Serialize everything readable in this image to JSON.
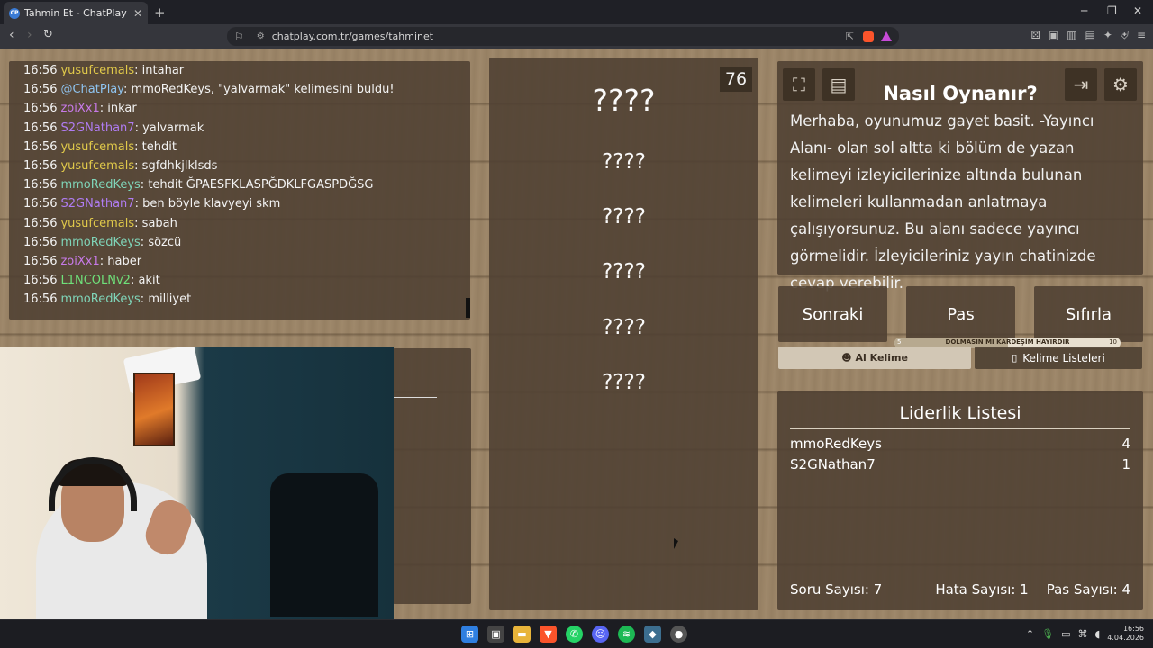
{
  "browser": {
    "tab_title": "Tahmin Et - ChatPlay",
    "tab_favicon": "CP",
    "url": "chatplay.com.tr/games/tahminet"
  },
  "chat": {
    "messages": [
      {
        "time": "16:56",
        "user": "yusufcemals",
        "color": "#e0c94a",
        "text": "intahar"
      },
      {
        "time": "16:56",
        "user": "@ChatPlay",
        "color": "#8fc4f0",
        "text": "mmoRedKeys, \"yalvarmak\" kelimesini buldu!"
      },
      {
        "time": "16:56",
        "user": "zoiXx1",
        "color": "#c77ae8",
        "text": "inkar"
      },
      {
        "time": "16:56",
        "user": "S2GNathan7",
        "color": "#b07cf2",
        "text": "yalvarmak"
      },
      {
        "time": "16:56",
        "user": "yusufcemals",
        "color": "#e0c94a",
        "text": "tehdit"
      },
      {
        "time": "16:56",
        "user": "yusufcemals",
        "color": "#e0c94a",
        "text": "sgfdhkjlklsds"
      },
      {
        "time": "16:56",
        "user": "mmoRedKeys",
        "color": "#7fd4b8",
        "text": "tehdit ĞPAESFKLASPĞDKLFGASPDĞSG"
      },
      {
        "time": "16:56",
        "user": "S2GNathan7",
        "color": "#b07cf2",
        "text": "ben böyle klavyeyi skm"
      },
      {
        "time": "16:56",
        "user": "yusufcemals",
        "color": "#e0c94a",
        "text": "sabah"
      },
      {
        "time": "16:56",
        "user": "mmoRedKeys",
        "color": "#7fd4b8",
        "text": "sözcü"
      },
      {
        "time": "16:56",
        "user": "zoiXx1",
        "color": "#c77ae8",
        "text": "haber"
      },
      {
        "time": "16:56",
        "user": "L1NCOLNv2",
        "color": "#6fe07a",
        "text": "akit"
      },
      {
        "time": "16:56",
        "user": "mmoRedKeys",
        "color": "#7fd4b8",
        "text": "milliyet"
      }
    ]
  },
  "game": {
    "timer": "76",
    "main_word": "????",
    "forbidden_words": [
      "????",
      "????",
      "????",
      "????",
      "????"
    ]
  },
  "info": {
    "title": "Nasıl Oynanır?",
    "body": "Merhaba, oyunumuz gayet basit. -Yayıncı Alanı- olan sol altta ki bölüm de yazan kelimeyi izleyicilerinize altında bulunan kelimeleri kullanmadan anlatmaya çalışıyorsunuz. Bu alanı sadece yayıncı görmelidir. İzleyicileriniz yayın chatinizde cevap verebilir.",
    "icons": {
      "fullscreen": "fullscreen-icon",
      "document": "document-icon",
      "exit": "exit-icon",
      "settings": "gear-icon"
    }
  },
  "actions": {
    "next": "Sonraki",
    "pass": "Pas",
    "reset": "Sıfırla"
  },
  "progress": {
    "label": "DOLMASIN MI KARDEŞİM HAYIRDIR",
    "min": "5",
    "max": "10",
    "fraction": 0.5
  },
  "tabs": {
    "ai_word": "Al Kelime",
    "word_lists": "Kelime Listeleri"
  },
  "leaderboard": {
    "title": "Liderlik Listesi",
    "rows": [
      {
        "name": "mmoRedKeys",
        "score": "4"
      },
      {
        "name": "S2GNathan7",
        "score": "1"
      }
    ]
  },
  "stats": {
    "questions": "Soru Sayısı: 7",
    "errors": "Hata Sayısı: 1",
    "passes": "Pas Sayısı: 4"
  },
  "taskbar": {
    "time": "16:56",
    "date": "4.04.2026"
  }
}
